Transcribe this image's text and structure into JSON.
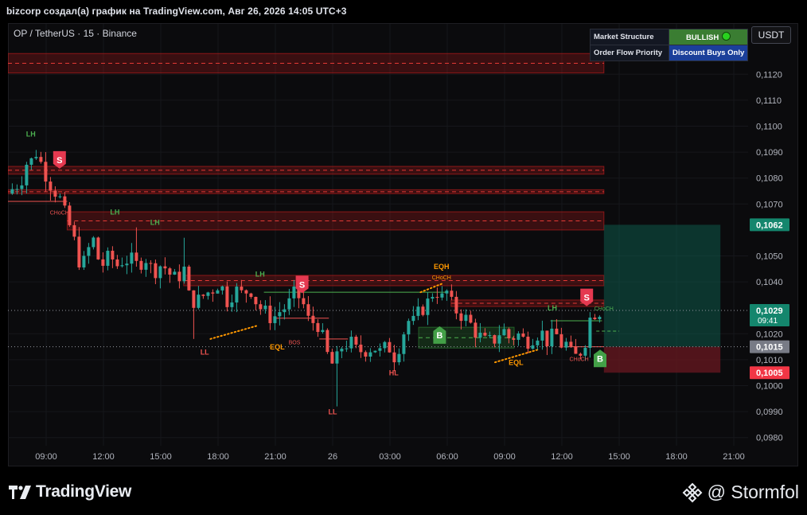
{
  "header": {
    "title": "bizcorp создал(а) график на TradingView.com, Авг 26, 2026 14:05 UTC+3"
  },
  "symbol": "OP / TetherUS · 15 · Binance",
  "currency_button": "USDT",
  "table": {
    "rows": [
      {
        "key": "Market Structure",
        "value": "BULLISH"
      },
      {
        "key": "Order Flow Priority",
        "value": "Discount Buys Only"
      }
    ]
  },
  "footer": {
    "brand": "TradingView",
    "watermark": "@ Stormfol"
  },
  "colors": {
    "up": "#26a69a",
    "down": "#ef5350",
    "background": "#0b0b0d",
    "bullish": "#3a7d32",
    "priority": "#1b3f9a",
    "signal_buy": "#43a047",
    "signal_sell": "#e53950"
  },
  "icons": {
    "brand": "tradingview-logo-icon",
    "watermark": "binance-diamond-icon"
  },
  "chart_data": {
    "type": "candlestick",
    "ylim": [
      0.0975,
      0.1135
    ],
    "y_ticks": [
      {
        "value": 0.112,
        "label": "0,1120"
      },
      {
        "value": 0.111,
        "label": "0,1110"
      },
      {
        "value": 0.11,
        "label": "0,1100"
      },
      {
        "value": 0.109,
        "label": "0,1090"
      },
      {
        "value": 0.108,
        "label": "0,1080"
      },
      {
        "value": 0.107,
        "label": "0,1070"
      },
      {
        "value": 0.105,
        "label": "0,1050"
      },
      {
        "value": 0.104,
        "label": "0,1040"
      },
      {
        "value": 0.102,
        "label": "0,1020"
      },
      {
        "value": 0.101,
        "label": "0,1010"
      },
      {
        "value": 0.1,
        "label": "0,1000"
      },
      {
        "value": 0.099,
        "label": "0,0990"
      },
      {
        "value": 0.098,
        "label": "0,0980"
      }
    ],
    "x_ticks": [
      {
        "h": 0,
        "label": "09:00"
      },
      {
        "h": 3,
        "label": "12:00"
      },
      {
        "h": 6,
        "label": "15:00"
      },
      {
        "h": 9,
        "label": "18:00"
      },
      {
        "h": 12,
        "label": "21:00"
      },
      {
        "h": 15,
        "label": "26"
      },
      {
        "h": 18,
        "label": "03:00"
      },
      {
        "h": 21,
        "label": "06:00"
      },
      {
        "h": 24,
        "label": "09:00"
      },
      {
        "h": 27,
        "label": "12:00"
      },
      {
        "h": 30,
        "label": "15:00"
      },
      {
        "h": 33,
        "label": "18:00"
      },
      {
        "h": 36,
        "label": "21:00"
      }
    ],
    "x_range_hours": [
      -2.0,
      37.0
    ],
    "candle_interval_minutes": 15,
    "anchors": [
      [
        -1.9,
        0.1074
      ],
      [
        -1.2,
        0.1079
      ],
      [
        -0.8,
        0.1088
      ],
      [
        -0.6,
        0.1086
      ],
      [
        -0.4,
        0.109
      ],
      [
        -0.1,
        0.1085
      ],
      [
        0.4,
        0.1077
      ],
      [
        0.8,
        0.1073
      ],
      [
        1.0,
        0.1068
      ],
      [
        1.2,
        0.1064
      ],
      [
        1.5,
        0.1059
      ],
      [
        1.7,
        0.1052
      ],
      [
        2.0,
        0.1045
      ],
      [
        2.3,
        0.1052
      ],
      [
        2.6,
        0.1056
      ],
      [
        2.8,
        0.105
      ],
      [
        3.0,
        0.1046
      ],
      [
        3.5,
        0.105
      ],
      [
        3.8,
        0.1046
      ],
      [
        4.2,
        0.1049
      ],
      [
        4.6,
        0.1048
      ],
      [
        4.9,
        0.1046
      ],
      [
        5.3,
        0.105
      ],
      [
        5.7,
        0.1044
      ],
      [
        6.2,
        0.1047
      ],
      [
        6.6,
        0.1043
      ],
      [
        7.0,
        0.104
      ],
      [
        7.3,
        0.1048
      ],
      [
        7.5,
        0.1035
      ],
      [
        8.0,
        0.1032
      ],
      [
        8.4,
        0.1035
      ],
      [
        8.8,
        0.1037
      ],
      [
        9.2,
        0.104
      ],
      [
        9.6,
        0.1033
      ],
      [
        10.0,
        0.1037
      ],
      [
        10.4,
        0.1035
      ],
      [
        10.8,
        0.1038
      ],
      [
        11.2,
        0.1031
      ],
      [
        11.6,
        0.1028
      ],
      [
        12.0,
        0.1026
      ],
      [
        12.4,
        0.1029
      ],
      [
        12.8,
        0.1031
      ],
      [
        13.2,
        0.1036
      ],
      [
        13.6,
        0.1031
      ],
      [
        13.9,
        0.1024
      ],
      [
        14.3,
        0.1025
      ],
      [
        14.6,
        0.1018
      ],
      [
        15.0,
        0.1008
      ],
      [
        15.3,
        0.1009
      ],
      [
        15.6,
        0.1015
      ],
      [
        16.0,
        0.1017
      ],
      [
        16.4,
        0.1013
      ],
      [
        16.8,
        0.1014
      ],
      [
        17.3,
        0.1015
      ],
      [
        17.7,
        0.1012
      ],
      [
        18.0,
        0.1016
      ],
      [
        18.4,
        0.1011
      ],
      [
        18.8,
        0.102
      ],
      [
        19.1,
        0.1025
      ],
      [
        19.4,
        0.1024
      ],
      [
        19.7,
        0.1029
      ],
      [
        20.1,
        0.1032
      ],
      [
        20.5,
        0.1038
      ],
      [
        20.8,
        0.1033
      ],
      [
        21.1,
        0.1036
      ],
      [
        21.4,
        0.103
      ],
      [
        21.8,
        0.1028
      ],
      [
        22.3,
        0.1024
      ],
      [
        22.8,
        0.1019
      ],
      [
        23.2,
        0.1016
      ],
      [
        23.6,
        0.1018
      ],
      [
        24.0,
        0.1022
      ],
      [
        24.4,
        0.1018
      ],
      [
        24.8,
        0.102
      ],
      [
        25.2,
        0.1017
      ],
      [
        25.6,
        0.1019
      ],
      [
        26.0,
        0.1021
      ],
      [
        26.4,
        0.1017
      ],
      [
        26.8,
        0.102
      ],
      [
        27.1,
        0.1016
      ],
      [
        27.4,
        0.1016
      ],
      [
        27.7,
        0.101
      ],
      [
        28.0,
        0.1012
      ],
      [
        28.3,
        0.1016
      ],
      [
        28.6,
        0.1026
      ],
      [
        28.9,
        0.1029
      ]
    ],
    "wick_extremes": [
      {
        "h": 15.0,
        "low": 0.0992
      },
      {
        "h": 7.6,
        "low": 0.1018
      },
      {
        "h": 4.5,
        "high": 0.1061
      },
      {
        "h": 7.0,
        "high": 0.1057
      }
    ],
    "price_labels": [
      {
        "value": 0.1062,
        "text": "0,1062",
        "color": "#14866d"
      },
      {
        "value": 0.1029,
        "text": "0,1029",
        "sub": "09:41",
        "color": "#14866d"
      },
      {
        "value": 0.1015,
        "text": "0,1015",
        "color": "#787b86"
      },
      {
        "value": 0.1005,
        "text": "0,1005",
        "color": "#f23645"
      }
    ],
    "zones": [
      {
        "h0": -2.0,
        "h1": 29.2,
        "top": 0.1128,
        "bottom": 0.11205,
        "kind": "supply"
      },
      {
        "h0": -2.0,
        "h1": 29.2,
        "top": 0.10845,
        "bottom": 0.10815,
        "kind": "supply"
      },
      {
        "h0": -2.0,
        "h1": 29.2,
        "top": 0.10755,
        "bottom": 0.1074,
        "kind": "supply"
      },
      {
        "h0": 1.1,
        "h1": 29.2,
        "top": 0.1067,
        "bottom": 0.106,
        "kind": "supply"
      },
      {
        "h0": 7.2,
        "h1": 29.2,
        "top": 0.10425,
        "bottom": 0.10385,
        "kind": "supply"
      },
      {
        "h0": 21.2,
        "h1": 29.2,
        "top": 0.1033,
        "bottom": 0.10305,
        "kind": "supply"
      },
      {
        "h0": 19.5,
        "h1": 24.5,
        "top": 0.10225,
        "bottom": 0.10145,
        "kind": "demand"
      }
    ],
    "position_box": {
      "h0": 29.2,
      "h1": 35.3,
      "entry": 0.1015,
      "target": 0.1062,
      "stop": 0.1005
    },
    "signals": [
      {
        "h": 0.7,
        "value": 0.1087,
        "text": "S",
        "side": "sell"
      },
      {
        "h": 13.4,
        "value": 0.1039,
        "text": "S",
        "side": "sell"
      },
      {
        "h": 20.6,
        "value": 0.10195,
        "text": "B",
        "side": "buy"
      },
      {
        "h": 28.3,
        "value": 0.1034,
        "text": "S",
        "side": "sell"
      },
      {
        "h": 29.0,
        "value": 0.10105,
        "text": "B",
        "side": "buy"
      }
    ],
    "annotations": [
      {
        "h": -0.8,
        "value": 0.1096,
        "text": "LH",
        "color": "#4caf50"
      },
      {
        "h": 3.6,
        "value": 0.1066,
        "text": "LH",
        "color": "#4caf50"
      },
      {
        "h": 5.7,
        "value": 0.1062,
        "text": "LH",
        "color": "#4caf50"
      },
      {
        "h": 11.2,
        "value": 0.1042,
        "text": "LH",
        "color": "#4caf50"
      },
      {
        "h": 26.5,
        "value": 0.1029,
        "text": "LH",
        "color": "#4caf50"
      },
      {
        "h": 8.3,
        "value": 0.1012,
        "text": "LL",
        "color": "#ef5350"
      },
      {
        "h": 15.0,
        "value": 0.0989,
        "text": "LL",
        "color": "#ef5350"
      },
      {
        "h": 18.2,
        "value": 0.1004,
        "text": "HL",
        "color": "#ef5350"
      },
      {
        "h": 12.1,
        "value": 0.1014,
        "text": "EQL",
        "color": "#ff9800"
      },
      {
        "h": 24.6,
        "value": 0.1008,
        "text": "EQL",
        "color": "#ff9800"
      },
      {
        "h": 20.7,
        "value": 0.1045,
        "text": "EQH",
        "color": "#ff9800"
      },
      {
        "h": 0.7,
        "value": 0.1066,
        "text": "CHoCH",
        "color": "#ef5350",
        "small": true
      },
      {
        "h": 20.7,
        "value": 0.1041,
        "text": "CHoCH",
        "color": "#ff9800",
        "small": true
      },
      {
        "h": 13.0,
        "value": 0.1016,
        "text": "BOS",
        "color": "#ef5350",
        "small": true
      },
      {
        "h": 27.9,
        "value": 0.10095,
        "text": "CHoCH",
        "color": "#ef5350",
        "small": true
      },
      {
        "h": 29.2,
        "value": 0.1029,
        "text": "CHoCH",
        "color": "#4caf50",
        "small": true
      }
    ],
    "lines": [
      {
        "h0": -2.0,
        "h1": 1.1,
        "value": 0.1071,
        "color": "#ef5350",
        "dash": false
      },
      {
        "h0": 11.4,
        "h1": 21.0,
        "value": 0.1036,
        "color": "#4caf50",
        "dash": false
      },
      {
        "h0": 12.0,
        "h1": 14.8,
        "value": 0.1026,
        "color": "#ef5350",
        "dash": false
      },
      {
        "h0": 14.3,
        "h1": 15.8,
        "value": 0.1018,
        "color": "#ef5350",
        "dash": false
      },
      {
        "h0": 26.4,
        "h1": 29.1,
        "value": 0.1025,
        "color": "#4caf50",
        "dash": false
      },
      {
        "h0": 27.1,
        "h1": 29.2,
        "value": 0.1015,
        "color": "#ef5350",
        "dash": false
      },
      {
        "h0": 28.8,
        "h1": 30.0,
        "value": 0.1021,
        "color": "#4caf50",
        "dash": true
      },
      {
        "h0": -2.0,
        "h1": 37.0,
        "value": 0.1029,
        "color": "#9598a1",
        "dash": true,
        "thin": true
      },
      {
        "h0": -2.0,
        "h1": 37.0,
        "value": 0.1015,
        "color": "#9598a1",
        "dash": true,
        "thin": true
      }
    ],
    "dotted_trends": [
      {
        "h0": 8.6,
        "v0": 0.1018,
        "h1": 11.0,
        "v1": 0.1023,
        "color": "#ff9800"
      },
      {
        "h0": 19.6,
        "v0": 0.1036,
        "h1": 20.8,
        "v1": 0.10395,
        "color": "#ff9800"
      },
      {
        "h0": 23.5,
        "v0": 0.1009,
        "h1": 25.8,
        "v1": 0.1014,
        "color": "#ff9800"
      }
    ]
  }
}
